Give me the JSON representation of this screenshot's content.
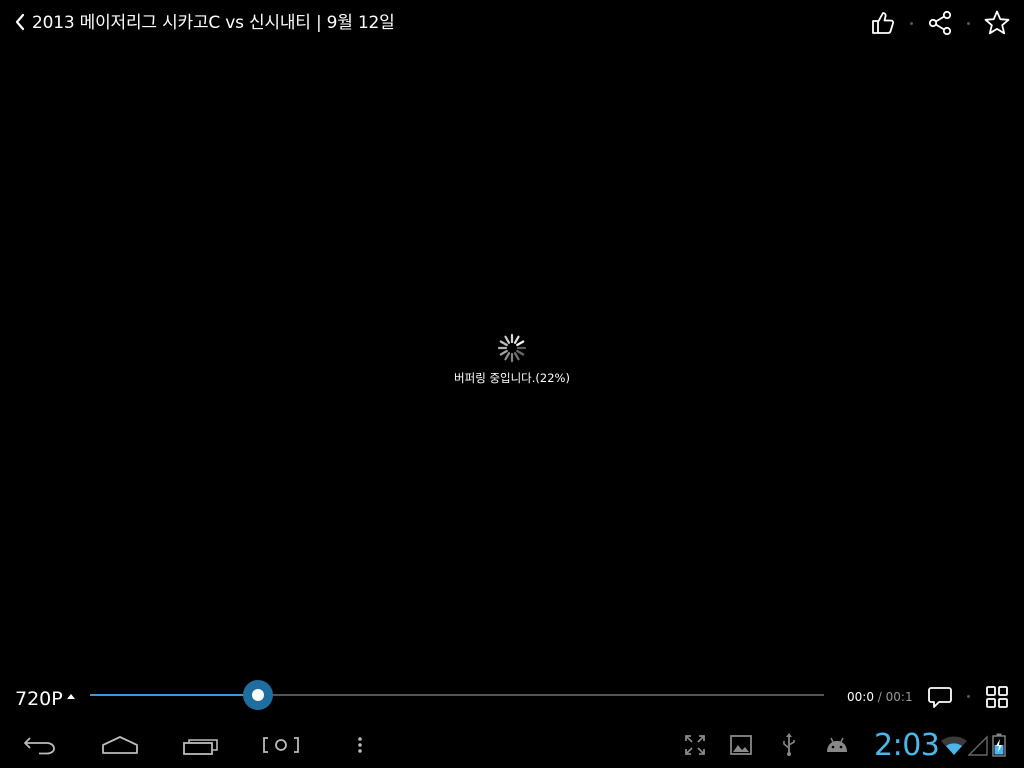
{
  "header": {
    "title": "2013 메이저리그 시카고C vs 신시내티 | 9월 12일",
    "back_icon": "chevron-left-icon",
    "actions": [
      {
        "name": "like",
        "icon": "thumbs-up-icon"
      },
      {
        "name": "share",
        "icon": "share-icon"
      },
      {
        "name": "favorite",
        "icon": "star-icon"
      }
    ]
  },
  "buffering": {
    "text": "버퍼링 중입니다.(22%)",
    "percent": 22,
    "icon": "spinner-icon"
  },
  "player": {
    "quality_label": "720P",
    "progress": 0.229,
    "current_time": "00:0",
    "separator": "/",
    "duration": "00:1",
    "comment_icon": "chat-bubble-icon",
    "grid_icon": "grid-icon",
    "accent_color": "#3a9ad9"
  },
  "system_bar": {
    "clock": "2:03",
    "clock_color": "#4cb6ea",
    "nav": [
      "back-icon",
      "home-icon",
      "recent-apps-icon",
      "screenshot-icon",
      "menu-icon"
    ],
    "status": [
      "fullscreen-icon",
      "gallery-icon",
      "usb-icon",
      "android-icon",
      "wifi-icon",
      "signal-icon",
      "battery-icon"
    ]
  }
}
